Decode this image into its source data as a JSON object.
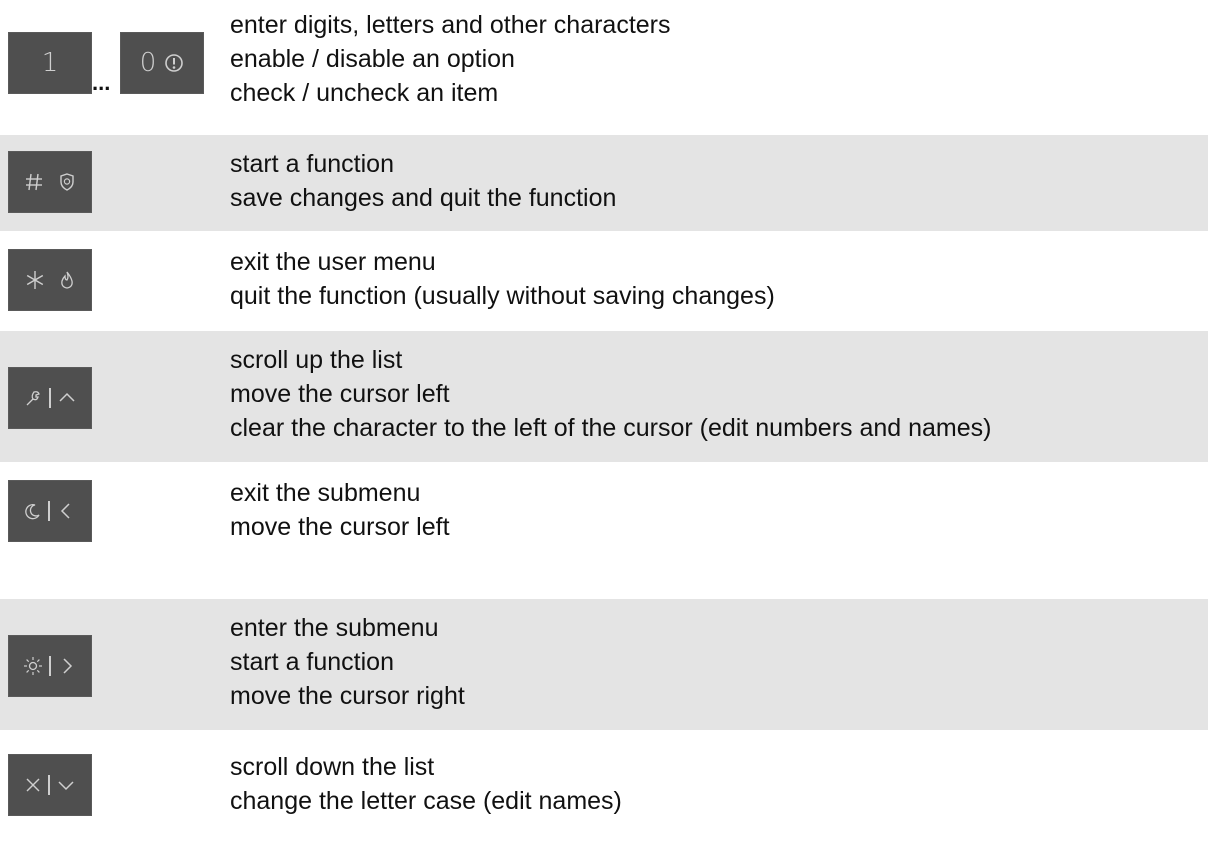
{
  "rows": [
    {
      "keys": [
        "1",
        "0"
      ],
      "ellipsis": "...",
      "lines": [
        "enter digits, letters and other characters",
        "enable / disable an option",
        "check / uncheck an item"
      ]
    },
    {
      "key_icons": [
        "hash-icon",
        "police-shield-icon"
      ],
      "lines": [
        "start a function",
        "save changes and quit the function"
      ]
    },
    {
      "key_icons": [
        "asterisk-icon",
        "fire-icon"
      ],
      "lines": [
        "exit the user menu",
        "quit the function (usually without saving changes)"
      ]
    },
    {
      "key_icons": [
        "wrench-icon",
        "chevron-up-icon"
      ],
      "lines": [
        "scroll up the list",
        "move the cursor left",
        "clear the character to the left of the cursor (edit numbers and names)"
      ]
    },
    {
      "key_icons": [
        "moon-icon",
        "chevron-left-icon"
      ],
      "lines": [
        "exit the submenu",
        "move the cursor left"
      ]
    },
    {
      "key_icons": [
        "sun-icon",
        "chevron-right-icon"
      ],
      "lines": [
        "enter the submenu",
        "start a function",
        "move the cursor right"
      ]
    },
    {
      "key_icons": [
        "close-icon",
        "chevron-down-icon"
      ],
      "lines": [
        "scroll down the list",
        "change the letter case (edit names)"
      ]
    }
  ],
  "colors": {
    "key_background": "#4f4f4f",
    "key_glyph": "#cfcfcf",
    "row_shade": "#e4e4e4"
  }
}
